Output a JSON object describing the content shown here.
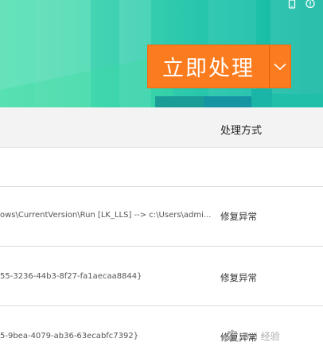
{
  "header": {
    "action_button": {
      "label": "立即处理"
    }
  },
  "icons": {
    "phone": "phone-icon",
    "info": "info-icon",
    "dropdown": "chevron-down-icon"
  },
  "table": {
    "columns": {
      "handle": "处理方式"
    },
    "rows": [
      {
        "item": "",
        "action": ""
      },
      {
        "item": "ows\\CurrentVersion\\Run [LK_LLS] --> c:\\Users\\admi...",
        "action": "修复异常"
      },
      {
        "item": "55-3236-44b3-8f27-fa1aecaa8844}",
        "action": "修复异常"
      },
      {
        "item": "5-9bea-4079-ab36-63ecabfc7392}",
        "action": "修复异常"
      }
    ]
  },
  "watermark": {
    "text": "Bai 经验"
  },
  "colors": {
    "accent": "#fb7c1e",
    "banner_teal": "#20c3aa"
  }
}
